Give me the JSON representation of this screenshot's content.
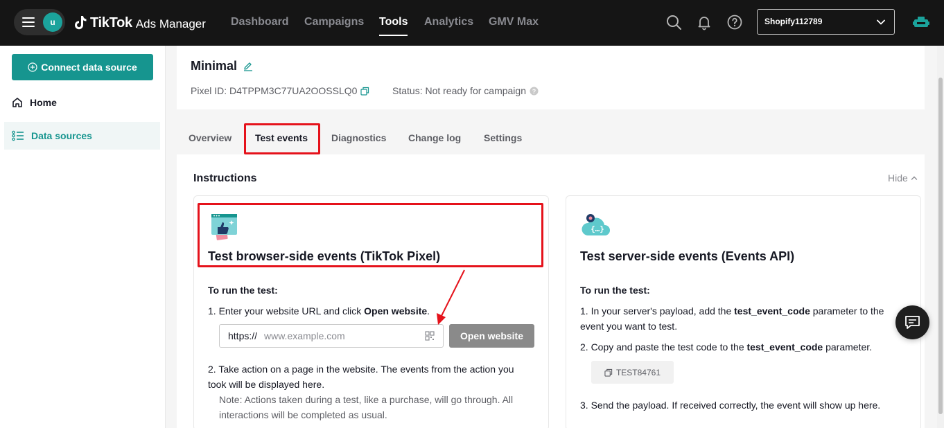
{
  "topbar": {
    "avatar_initial": "u",
    "brand_name": "TikTok",
    "product_name": "Ads Manager",
    "nav": [
      "Dashboard",
      "Campaigns",
      "Tools",
      "Analytics",
      "GMV Max"
    ],
    "active_nav": "Tools",
    "account": "Shopify112789"
  },
  "sidebar": {
    "connect_label": "Connect data source",
    "items": [
      {
        "label": "Home",
        "icon": "home-icon"
      },
      {
        "label": "Data sources",
        "icon": "list-icon",
        "active": true
      }
    ]
  },
  "pixel": {
    "name": "Minimal",
    "id_text": "Pixel ID: D4TPPM3C77UA2OOSSLQ0",
    "status_text": "Status: Not ready for campaign"
  },
  "tabs": [
    "Overview",
    "Test events",
    "Diagnostics",
    "Change log",
    "Settings"
  ],
  "active_tab": "Test events",
  "instructions": {
    "title": "Instructions",
    "hide_label": "Hide",
    "browser": {
      "title": "Test browser-side events (TikTok Pixel)",
      "run_heading": "To run the test:",
      "step1_prefix": "1. Enter your website URL and click ",
      "step1_bold": "Open website",
      "step1_suffix": ".",
      "url_prefix": "https://",
      "url_placeholder": "www.example.com",
      "open_button": "Open website",
      "step2_line1": "2. Take action on a page in the website. The events from the action you",
      "step2_line2": "took will be displayed here.",
      "note_line1": "Note: Actions taken during a test, like a purchase, will go through. All",
      "note_line2": "interactions will be completed as usual."
    },
    "server": {
      "title": "Test server-side events (Events API)",
      "run_heading": "To run the test:",
      "step1_prefix": "1. In your server's payload, add the ",
      "step1_bold": "test_event_code",
      "step1_suffix": " parameter to the",
      "step1_line2": "event you want to test.",
      "step2_prefix": "2. Copy and paste the test code to the ",
      "step2_bold": "test_event_code",
      "step2_suffix": " parameter.",
      "test_code": "TEST84761",
      "step3": "3. Send the payload. If received correctly, the event will show up here."
    }
  },
  "colors": {
    "brand_teal": "#16958f",
    "highlight_red": "#e5121b",
    "topbar_bg": "#151515"
  }
}
